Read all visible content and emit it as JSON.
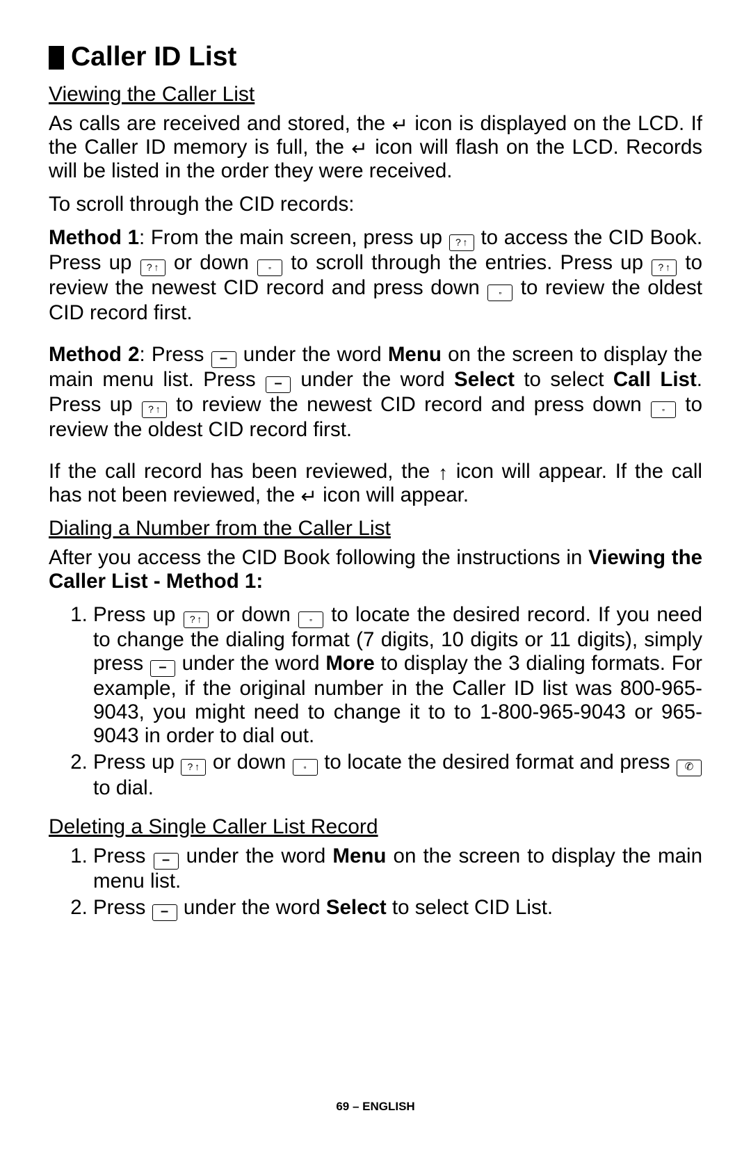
{
  "title": "Caller ID List",
  "s1": {
    "head": "Viewing the Caller List",
    "p1a": "As calls are received and stored, the ",
    "p1b": " icon is displayed on the LCD.  If the Caller ID memory is full, the ",
    "p1c": " icon will flash on the LCD.  Records will be listed in the order they were received.",
    "p2": "To scroll through the CID records:",
    "m1label": "Method 1",
    "m1a": ": From the main screen, press up",
    "m1b": "to access the CID Book. Press up",
    "m1c": "or down",
    "m1d": "to scroll through the entries. Press up ",
    "m1e": "to review the newest CID record and press down",
    "m1f": " to review the oldest CID record first.",
    "m2label": "Method 2",
    "m2a": ": Press ",
    "m2b": "under the word ",
    "menu": "Menu",
    "m2c": " on the screen to display the main menu list. Press ",
    "m2d": "under the word ",
    "select": "Select",
    "m2e": " to select ",
    "calllist": "Call List",
    "m2f": ". Press up ",
    "m2g": " to review the newest CID record and press down ",
    "m2h": " to review the oldest CID record first.",
    "p3a": "If the call record has been reviewed, the ",
    "upglyph": "↑",
    "p3b": " icon will appear.  If the call has not been reviewed, the ",
    "p3c": " icon will appear."
  },
  "s2": {
    "head": "Dialing a Number from the Caller List",
    "introA": "After you access the CID Book following the instructions in ",
    "introBold": "Viewing the Caller List -  Method 1:",
    "li1a": "Press up",
    "li1b": "or down",
    "li1c": "to locate the desired record. If you need to change the dialing format (7 digits, 10 digits or 11 digits), simply press ",
    "li1d": "under the word ",
    "more": "More",
    "li1e": " to display the 3 dialing formats. For example, if the original number in the Caller ID list was 800-965-9043, you might need to change it to to 1-800-965-9043 or 965-9043 in order to dial out.",
    "li2a": "Press up ",
    "li2b": "or down ",
    "li2c": " to locate the desired format and press ",
    "li2d": " to dial."
  },
  "s3": {
    "head": "Deleting a Single Caller List Record",
    "li1a": "Press ",
    "li1b": " under the word ",
    "menu": "Menu",
    "li1c": " on the screen to display the main menu list.",
    "li2a": "Press ",
    "li2b": "under the word ",
    "select": "Select",
    "li2c": " to select CID List."
  },
  "footer": "69 – ENGLISH"
}
